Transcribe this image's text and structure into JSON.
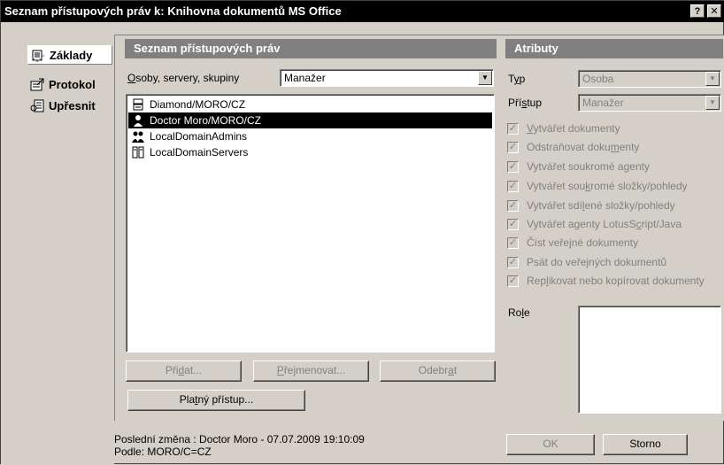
{
  "window": {
    "title": "Seznam přístupových práv k: Knihovna dokumentů MS Office",
    "help_glyph": "?",
    "close_glyph": "✕"
  },
  "nav": {
    "items": [
      {
        "label": "Základy",
        "icon": "folder-icon",
        "active": true
      },
      {
        "label": "Protokol",
        "icon": "protocol-icon",
        "active": false
      },
      {
        "label": "Upřesnit",
        "icon": "advanced-icon",
        "active": false
      }
    ]
  },
  "acl": {
    "header": "Seznam přístupových práv",
    "people_label_first": "O",
    "people_label_rest": "soby, servery, skupiny",
    "level_value": "Manažer",
    "entries": [
      {
        "name": "Diamond/MORO/CZ",
        "icon": "server-icon",
        "selected": false
      },
      {
        "name": "Doctor Moro/MORO/CZ",
        "icon": "person-icon",
        "selected": true
      },
      {
        "name": "LocalDomainAdmins",
        "icon": "group-icon",
        "selected": false
      },
      {
        "name": "LocalDomainServers",
        "icon": "server-group-icon",
        "selected": false
      }
    ],
    "add_button": {
      "pre": "Při",
      "u": "d",
      "post": "at..."
    },
    "rename_button": {
      "pre": "",
      "u": "P",
      "post": "řejmenovat..."
    },
    "remove_button": {
      "pre": "Odebr",
      "u": "a",
      "post": "t"
    },
    "effective_button": {
      "pre": "Pla",
      "u": "t",
      "post": "ný přístup..."
    }
  },
  "attributes": {
    "header": "Atributy",
    "type_label": {
      "pre": "T",
      "u": "y",
      "post": "p"
    },
    "type_value": "Osoba",
    "access_label": {
      "pre": "Pří",
      "u": "s",
      "post": "tup"
    },
    "access_value": "Manažer",
    "checkboxes": [
      {
        "pre": "",
        "u": "V",
        "post": "ytvářet dokumenty",
        "checked": true
      },
      {
        "pre": "Odstraňovat doku",
        "u": "m",
        "post": "enty",
        "checked": true
      },
      {
        "pre": "Vytvářet soukromé agenty",
        "u": "",
        "post": "",
        "checked": true
      },
      {
        "pre": "Vytvářet sou",
        "u": "k",
        "post": "romé složky/pohledy",
        "checked": true
      },
      {
        "pre": "Vytvářet sdí",
        "u": "l",
        "post": "ené složky/pohledy",
        "checked": true
      },
      {
        "pre": "Vytvářet agenty LotusS",
        "u": "c",
        "post": "ript/Java",
        "checked": true
      },
      {
        "pre": "Číst veře",
        "u": "j",
        "post": "né dokumenty",
        "checked": true
      },
      {
        "pre": "Psát do veřejných dokumentů",
        "u": "",
        "post": "",
        "checked": true
      },
      {
        "pre": "Rep",
        "u": "l",
        "post": "ikovat nebo kopírovat dokumenty",
        "checked": true
      }
    ],
    "role_label": {
      "pre": "Ro",
      "u": "l",
      "post": "e"
    }
  },
  "footer": {
    "last_change": "Poslední změna : Doctor Moro - 07.07.2009 19:10:09",
    "by": "Podle: MORO/C=CZ",
    "ok_label": "OK",
    "cancel_label": "Storno"
  }
}
